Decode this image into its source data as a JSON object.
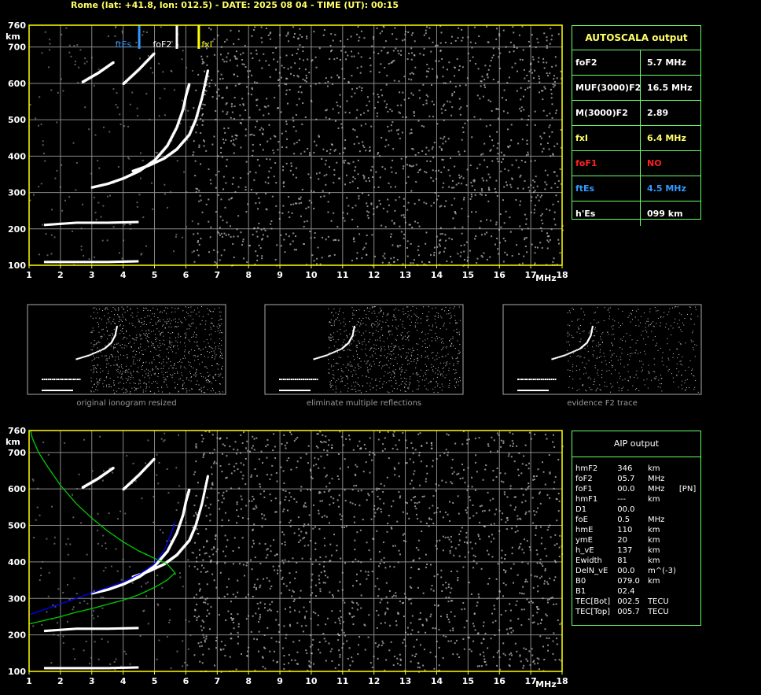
{
  "header": {
    "title": "Rome (lat: +41.8, lon: 012.5) - DATE: 2025 08 04 - TIME (UT): 00:15"
  },
  "colors": {
    "grid": "#888888",
    "axis": "#ffff00",
    "trace": "#ffffff",
    "panel_border": "#66ff66",
    "label_yellow": "#ffff66",
    "label_red": "#ff2020",
    "label_blue": "#3399ff",
    "model_green": "#00cc00",
    "profile_blue": "#0000ff"
  },
  "chart_data": [
    {
      "type": "scatter",
      "title": "",
      "xlabel": "MHz",
      "ylabel": "km",
      "xlim": [
        1,
        18
      ],
      "ylim": [
        100,
        760
      ],
      "x_ticks": [
        "1",
        "2",
        "3",
        "4",
        "5",
        "6",
        "7",
        "8",
        "9",
        "10",
        "11",
        "12",
        "13",
        "14",
        "15",
        "16",
        "17",
        "18"
      ],
      "y_ticks": [
        "100",
        "200",
        "300",
        "400",
        "500",
        "600",
        "700",
        "760"
      ],
      "grid": true,
      "markers": [
        {
          "label": "ftEs",
          "x": 4.5,
          "color": "#3399ff"
        },
        {
          "label": "foF2",
          "x": 5.7,
          "color": "#ffffff"
        },
        {
          "label": "fxI",
          "x": 6.4,
          "color": "#ffff00"
        }
      ],
      "series": [
        {
          "name": "",
          "x": [
            1.5,
            2.5,
            3.5,
            4.5
          ],
          "y": [
            110,
            110,
            110,
            112
          ]
        },
        {
          "name": "",
          "x": [
            1.5,
            2.5,
            3.5,
            4.5
          ],
          "y": [
            212,
            218,
            218,
            220
          ]
        },
        {
          "name": "",
          "x": [
            3.0,
            3.5,
            4.0,
            4.5,
            5.0,
            5.4,
            5.7,
            5.9,
            6.0,
            6.1
          ],
          "y": [
            315,
            325,
            340,
            360,
            390,
            430,
            480,
            530,
            570,
            600
          ]
        },
        {
          "name": "",
          "x": [
            4.3,
            4.8,
            5.3,
            5.7,
            6.1,
            6.3,
            6.5,
            6.7
          ],
          "y": [
            360,
            375,
            395,
            420,
            460,
            500,
            560,
            640
          ]
        },
        {
          "name": "",
          "x": [
            2.7,
            3.2,
            3.7
          ],
          "y": [
            605,
            630,
            660
          ]
        },
        {
          "name": "",
          "x": [
            4.0,
            4.5,
            5.0
          ],
          "y": [
            600,
            640,
            685
          ]
        }
      ]
    },
    {
      "type": "scatter",
      "title": "",
      "xlabel": "MHz",
      "ylabel": "km",
      "xlim": [
        1,
        18
      ],
      "ylim": [
        100,
        760
      ],
      "x_ticks": [
        "1",
        "2",
        "3",
        "4",
        "5",
        "6",
        "7",
        "8",
        "9",
        "10",
        "11",
        "12",
        "13",
        "14",
        "15",
        "16",
        "17",
        "18"
      ],
      "y_ticks": [
        "100",
        "200",
        "300",
        "400",
        "500",
        "600",
        "700",
        "760"
      ],
      "grid": true,
      "series": [
        {
          "name": "",
          "x": [
            1.5,
            2.5,
            3.5,
            4.5
          ],
          "y": [
            110,
            110,
            110,
            112
          ]
        },
        {
          "name": "",
          "x": [
            1.5,
            2.5,
            3.5,
            4.5
          ],
          "y": [
            212,
            218,
            218,
            220
          ]
        },
        {
          "name": "",
          "x": [
            3.0,
            3.5,
            4.0,
            4.5,
            5.0,
            5.4,
            5.7,
            5.9,
            6.0,
            6.1
          ],
          "y": [
            315,
            325,
            340,
            360,
            390,
            430,
            480,
            530,
            570,
            600
          ]
        },
        {
          "name": "",
          "x": [
            4.3,
            4.8,
            5.3,
            5.7,
            6.1,
            6.3,
            6.5,
            6.7
          ],
          "y": [
            360,
            375,
            395,
            420,
            460,
            500,
            560,
            640
          ]
        },
        {
          "name": "",
          "x": [
            2.7,
            3.2,
            3.7
          ],
          "y": [
            605,
            630,
            660
          ]
        },
        {
          "name": "",
          "x": [
            4.0,
            4.5,
            5.0
          ],
          "y": [
            600,
            640,
            685
          ]
        }
      ],
      "lines": [
        {
          "color": "#00cc00",
          "x": [
            1.0,
            1.5,
            2.0,
            2.5,
            3.0,
            3.5,
            4.0,
            4.5,
            5.0,
            5.4,
            5.65,
            5.4,
            5.0,
            4.5,
            4.0,
            3.5,
            3.0,
            2.5,
            2.0,
            1.6,
            1.3,
            1.1,
            1.05
          ],
          "y": [
            230,
            240,
            250,
            262,
            272,
            284,
            295,
            310,
            330,
            350,
            370,
            395,
            410,
            430,
            455,
            485,
            520,
            560,
            610,
            660,
            700,
            740,
            760
          ]
        },
        {
          "color": "#0000ff",
          "x": [
            1.0,
            1.5,
            2.0,
            2.5,
            3.0,
            3.5,
            4.0,
            4.5,
            5.0,
            5.3,
            5.5,
            5.65
          ],
          "y": [
            255,
            270,
            285,
            300,
            315,
            330,
            345,
            365,
            395,
            430,
            470,
            510
          ]
        }
      ]
    }
  ],
  "thumbnails": [
    {
      "caption": "original ionogram resized"
    },
    {
      "caption": "eliminate multiple reflections"
    },
    {
      "caption": "evidence F2 trace"
    }
  ],
  "autoscala": {
    "title": "AUTOSCALA output",
    "rows": [
      {
        "label": "foF2",
        "value": "5.7 MHz",
        "color": "#ffffff"
      },
      {
        "label": "MUF(3000)F2",
        "value": "16.5 MHz",
        "color": "#ffffff"
      },
      {
        "label": "M(3000)F2",
        "value": "2.89",
        "color": "#ffffff"
      },
      {
        "label": "fxI",
        "value": "6.4 MHz",
        "color": "#ffff66"
      },
      {
        "label": "foF1",
        "value": "NO",
        "color": "#ff2020"
      },
      {
        "label": "ftEs",
        "value": "4.5 MHz",
        "color": "#3399ff"
      },
      {
        "label": "h'Es",
        "value": "099    km",
        "color": "#ffffff"
      }
    ]
  },
  "aip": {
    "title": "AIP output",
    "rows": [
      {
        "name": "hmF2",
        "value": "346",
        "unit": "km",
        "extra": ""
      },
      {
        "name": "foF2",
        "value": "05.7",
        "unit": "MHz",
        "extra": ""
      },
      {
        "name": "foF1",
        "value": "00.0",
        "unit": "MHz",
        "extra": "[PN]"
      },
      {
        "name": "hmF1",
        "value": "---",
        "unit": "km",
        "extra": ""
      },
      {
        "name": "D1",
        "value": "00.0",
        "unit": "",
        "extra": ""
      },
      {
        "name": "foE",
        "value": "0.5",
        "unit": "MHz",
        "extra": ""
      },
      {
        "name": "hmE",
        "value": "110",
        "unit": "km",
        "extra": ""
      },
      {
        "name": "ymE",
        "value": "20",
        "unit": "km",
        "extra": ""
      },
      {
        "name": "h_vE",
        "value": "137",
        "unit": "km",
        "extra": ""
      },
      {
        "name": "Ewidth",
        "value": "81",
        "unit": "km",
        "extra": ""
      },
      {
        "name": "DelN_vE",
        "value": "00.0",
        "unit": "m^(-3)",
        "extra": ""
      },
      {
        "name": "B0",
        "value": "079.0",
        "unit": "km",
        "extra": ""
      },
      {
        "name": "B1",
        "value": "02.4",
        "unit": "",
        "extra": ""
      },
      {
        "name": "TEC[Bot]",
        "value": "002.5",
        "unit": "TECU",
        "extra": ""
      },
      {
        "name": "TEC[Top]",
        "value": "005.7",
        "unit": "TECU",
        "extra": ""
      }
    ]
  }
}
